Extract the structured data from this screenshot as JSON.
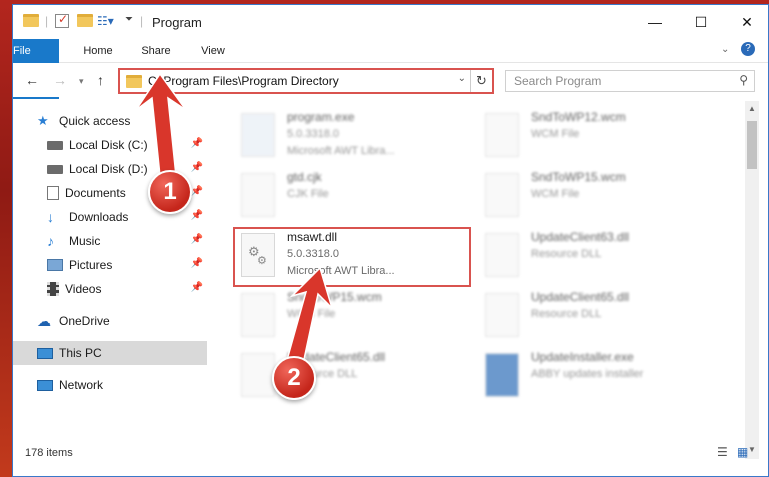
{
  "window": {
    "title": "Program"
  },
  "ribbon": {
    "tabs": [
      "File",
      "Home",
      "Share",
      "View"
    ]
  },
  "address": {
    "path": "C:\\Program Files\\Program Directory"
  },
  "search": {
    "placeholder": "Search Program"
  },
  "sidebar": {
    "items": [
      {
        "label": "Quick access",
        "icon": "star-icon"
      },
      {
        "label": "Local Disk (C:)",
        "icon": "drive-icon",
        "pinned": true
      },
      {
        "label": "Local Disk (D:)",
        "icon": "drive-icon",
        "pinned": true
      },
      {
        "label": "Documents",
        "icon": "documents-icon",
        "pinned": true
      },
      {
        "label": "Downloads",
        "icon": "download-icon",
        "pinned": true
      },
      {
        "label": "Music",
        "icon": "music-icon",
        "pinned": true
      },
      {
        "label": "Pictures",
        "icon": "pictures-icon",
        "pinned": true
      },
      {
        "label": "Videos",
        "icon": "videos-icon",
        "pinned": true
      },
      {
        "label": "OneDrive",
        "icon": "cloud-icon"
      },
      {
        "label": "This PC",
        "icon": "pc-icon",
        "selected": true
      },
      {
        "label": "Network",
        "icon": "network-icon"
      }
    ]
  },
  "files": {
    "left": [
      {
        "name": "program.exe",
        "line2": "5.0.3318.0",
        "line3": "Microsoft AWT Libra..."
      },
      {
        "name": "gtd.cjk",
        "line2": "CJK File"
      },
      {
        "name": "msawt.dll",
        "line2": "5.0.3318.0",
        "line3": "Microsoft AWT Libra...",
        "focused": true
      },
      {
        "name": "SndToWP15.wcm",
        "line2": "WCM File"
      },
      {
        "name": "UpdateClient65.dll",
        "line2": "Resource DLL"
      }
    ],
    "right": [
      {
        "name": "SndToWP12.wcm",
        "line2": "WCM File"
      },
      {
        "name": "SndToWP15.wcm",
        "line2": "WCM File"
      },
      {
        "name": "UpdateClient63.dll",
        "line2": "Resource DLL"
      },
      {
        "name": "UpdateClient65.dll",
        "line2": "Resource DLL"
      },
      {
        "name": "UpdateInstaller.exe",
        "line2": "ABBY updates installer"
      }
    ]
  },
  "status": {
    "count": "178 items"
  },
  "markers": {
    "one": "1",
    "two": "2"
  },
  "colors": {
    "accent": "#1979ca",
    "highlight": "#d9534f"
  }
}
